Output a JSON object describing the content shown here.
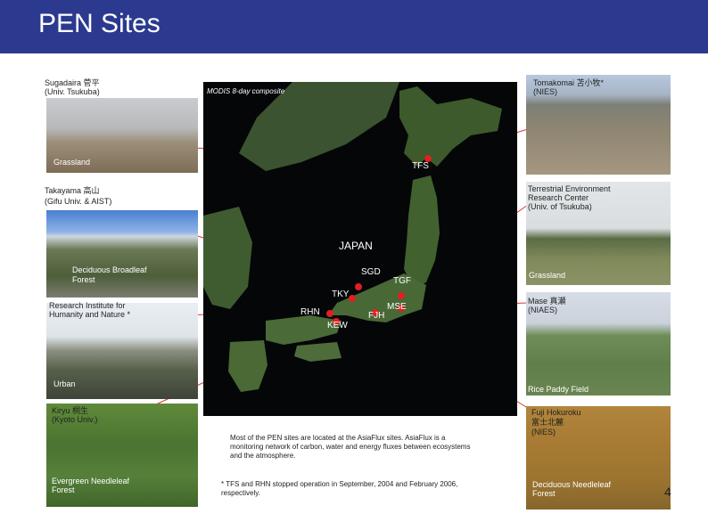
{
  "header": {
    "title": "PEN Sites"
  },
  "map": {
    "caption": "MODIS 8-day composite",
    "country": "JAPAN",
    "sites": [
      "TFS",
      "SGD",
      "TGF",
      "TKY",
      "RHN",
      "MSE",
      "FJH",
      "KEW"
    ]
  },
  "panels": {
    "sugadaira": {
      "name": "Sugadaira 菅平",
      "org": "(Univ. Tsukuba)",
      "type": "Grassland"
    },
    "takayama": {
      "name": "Takayama 高山",
      "org": "(Gifu Univ. & AIST)",
      "type1": "Deciduous Broadleaf",
      "type2": "Forest"
    },
    "rihn": {
      "name1": "Research Institute for",
      "name2": "Humanity and Nature *",
      "type": "Urban"
    },
    "kiryu": {
      "name": "Kiryu 桐生",
      "org": "(Kyoto Univ.)",
      "type1": "Evergreen Needleleaf",
      "type2": "Forest"
    },
    "tomakomai": {
      "name": "Tomakomai 苫小牧*",
      "org": "(NIES)"
    },
    "terc": {
      "name1": "Terrestrial Environment",
      "name2": "Research Center",
      "org": "(Univ. of Tsukuba)",
      "type": "Grassland"
    },
    "mase": {
      "name": "Mase 真瀬",
      "org": "(NIAES)",
      "type": "Rice Paddy Field"
    },
    "fuji": {
      "name1": "Fuji Hokuroku",
      "name2": "富士北麓",
      "org": "(NIES)",
      "type1": "Deciduous Needleleaf",
      "type2": "Forest"
    }
  },
  "notes": {
    "asiaflux1": "Most of the PEN sites are located at the AsiaFlux sites. AsiaFlux is a",
    "asiaflux2": "monitoring network of carbon, water and energy fluxes between ecosystems",
    "asiaflux3": "and the atmosphere.",
    "stopped1": "* TFS and RHN stopped operation in September, 2004 and February 2006,",
    "stopped2": "respectively."
  },
  "page_number": "4",
  "colors": {
    "header": "#2b3a8f",
    "site_dot": "#e0201f"
  }
}
